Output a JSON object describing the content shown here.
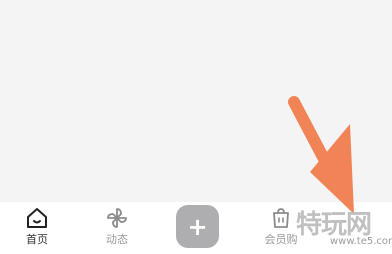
{
  "tabbar": {
    "tabs": [
      {
        "label": "首页",
        "icon": "home-icon",
        "active": true
      },
      {
        "label": "动态",
        "icon": "pinwheel-icon",
        "active": false
      },
      {
        "label": "会员购",
        "icon": "shopping-bag-icon",
        "active": false
      }
    ],
    "add_label": "+"
  },
  "watermark": {
    "text": "特玩网",
    "domain": "www.te5.com"
  },
  "colors": {
    "arrow": "#f08457",
    "add_button": "#aeaeb0",
    "active_label": "#333333",
    "inactive_label": "#9a9a9a"
  }
}
